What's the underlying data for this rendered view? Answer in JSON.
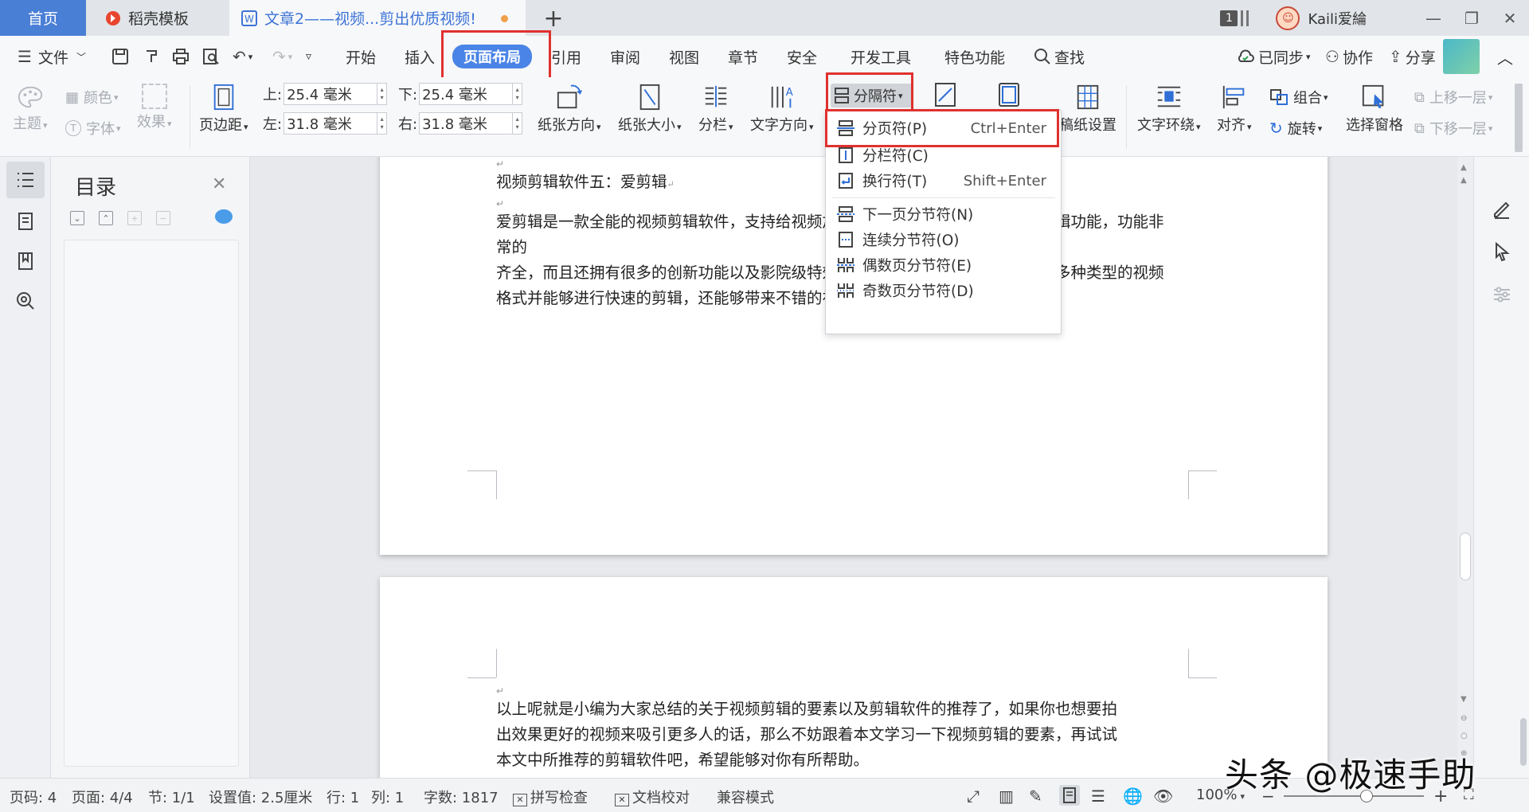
{
  "titlebar": {
    "tabs": [
      {
        "label": "首页"
      },
      {
        "label": "稻壳模板"
      },
      {
        "label": "文章2——视频...剪出优质视频!"
      }
    ],
    "window_count": "1",
    "username": "Kaili爱綸"
  },
  "menubar": {
    "file": "文件",
    "items": [
      "开始",
      "插入",
      "页面布局",
      "引用",
      "审阅",
      "视图",
      "章节",
      "安全",
      "开发工具",
      "特色功能"
    ],
    "search": "查找",
    "synced": "已同步",
    "collab": "协作",
    "share": "分享"
  },
  "ribbon": {
    "theme": "主题",
    "color": "颜色",
    "font": "字体",
    "effect": "效果",
    "margins": "页边距",
    "top_label": "上:",
    "top_value": "25.4 毫米",
    "bottom_label": "下:",
    "bottom_value": "25.4 毫米",
    "left_label": "左:",
    "left_value": "31.8 毫米",
    "right_label": "右:",
    "right_value": "31.8 毫米",
    "orientation": "纸张方向",
    "size": "纸张大小",
    "columns": "分栏",
    "text_direction": "文字方向",
    "breaks": "分隔符",
    "draft_settings": "稿纸设置",
    "text_wrap": "文字环绕",
    "align": "对齐",
    "group": "组合",
    "rotate": "旋转",
    "selection_pane": "选择窗格",
    "bring_forward": "上移一层",
    "send_backward": "下移一层"
  },
  "dropdown": {
    "items": [
      {
        "label": "分页符(P)",
        "shortcut": "Ctrl+Enter"
      },
      {
        "label": "分栏符(C)",
        "shortcut": ""
      },
      {
        "label": "换行符(T)",
        "shortcut": "Shift+Enter"
      },
      {
        "label": "下一页分节符(N)",
        "shortcut": ""
      },
      {
        "label": "连续分节符(O)",
        "shortcut": ""
      },
      {
        "label": "偶数页分节符(E)",
        "shortcut": ""
      },
      {
        "label": "奇数页分节符(D)",
        "shortcut": ""
      }
    ]
  },
  "toc": {
    "title": "目录"
  },
  "document": {
    "heading": "视频剪辑软件五：爱剪辑",
    "p1_lines": [
      "爱剪辑是一款全能的视频剪辑软件，支持给视频加字幕、调色、加相框等齐全的剪辑功能，功能非常的",
      "齐全，而且还拥有很多的创新功能以及影院级特效。它的操作简单，不仅可以支持多种类型的视频",
      "格式并能够进行快速的剪辑，还能够带来不错的视频效果，特别适合小白使用。"
    ],
    "p2_lines": [
      "以上呢就是小编为大家总结的关于视频剪辑的要素以及剪辑软件的推荐了，如果你也想要拍",
      "出效果更好的视频来吸引更多人的话，那么不妨跟着本文学习一下视频剪辑的要素，再试试",
      "本文中所推荐的剪辑软件吧，希望能够对你有所帮助。"
    ]
  },
  "statusbar": {
    "page_code": "页码: 4",
    "page": "页面: 4/4",
    "section": "节: 1/1",
    "setting": "设置值: 2.5厘米",
    "row": "行: 1",
    "col": "列: 1",
    "words": "字数: 1817",
    "spellcheck": "拼写检查",
    "proofread": "文档校对",
    "compat": "兼容模式",
    "zoom": "100%"
  },
  "watermark": "头条 @极速手助"
}
